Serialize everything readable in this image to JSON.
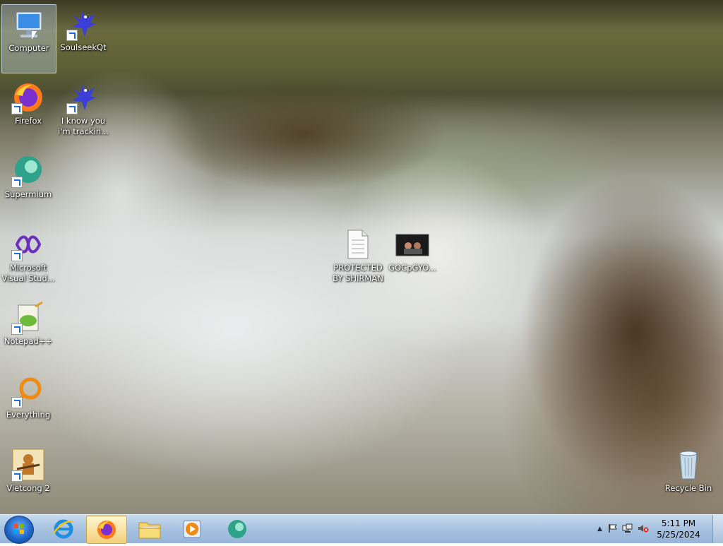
{
  "desktop": {
    "icons": [
      {
        "label": "Computer"
      },
      {
        "label": "SoulseekQt"
      },
      {
        "label": "Firefox"
      },
      {
        "label": "I know you i'm trackin..."
      },
      {
        "label": "Supermium"
      },
      {
        "label": "Microsoft Visual Stud..."
      },
      {
        "label": "Notepad++"
      },
      {
        "label": "Everything"
      },
      {
        "label": "Vietcong 2"
      },
      {
        "label": "PROTECTED BY SHIRMAN"
      },
      {
        "label": "GOCpGYO..."
      },
      {
        "label": "Recycle Bin"
      }
    ]
  },
  "taskbar": {
    "pinned": [
      "start-orb",
      "internet-explorer-icon",
      "firefox-icon",
      "file-explorer-icon",
      "media-player-icon",
      "supermium-icon"
    ],
    "active_app": "Firefox",
    "clock": {
      "time": "5:11 PM",
      "date": "5/25/2024"
    }
  },
  "colors": {
    "taskbar_top": "#c9dcef",
    "taskbar_bottom": "#95b4d9",
    "label_text": "#ffffff"
  }
}
